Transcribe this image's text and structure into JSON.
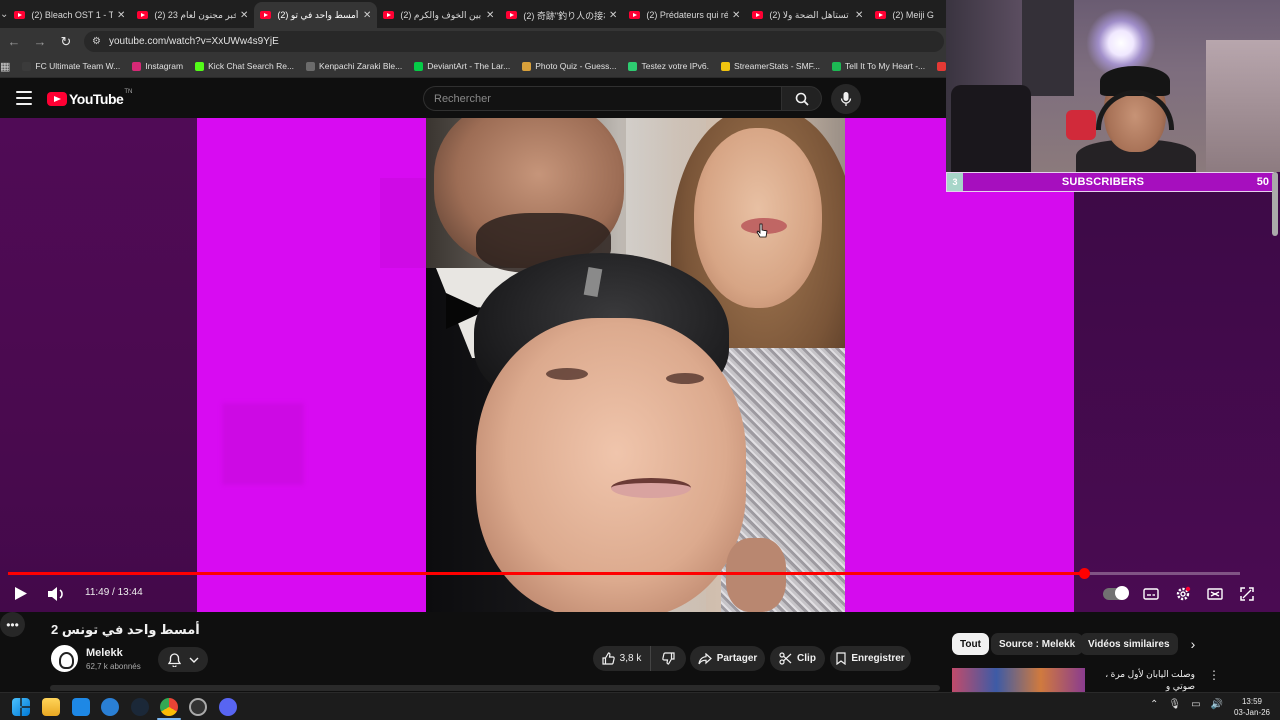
{
  "browser": {
    "tabs": [
      {
        "title": "(2) Bleach OST 1 - Tra",
        "active": false
      },
      {
        "title": "(2) 23 خبر مجنون لعام",
        "active": false
      },
      {
        "title": "(2) أمسط واحد في تو",
        "active": true
      },
      {
        "title": "(2) بين الخوف والكرم",
        "active": false
      },
      {
        "title": "(2) 奇跡\"釣り人の接れ",
        "active": false
      },
      {
        "title": "(2) Prédateurs qui ré",
        "active": false
      },
      {
        "title": "(2) تستاهل الضحة ولا",
        "active": false
      },
      {
        "title": "(2) Meiji G",
        "active": false
      }
    ],
    "url": "youtube.com/watch?v=XxUWw4s9YjE",
    "bookmarks": [
      {
        "label": "FC Ultimate Team W...",
        "color": "#3b3b3b"
      },
      {
        "label": "Instagram",
        "color": "#d62976"
      },
      {
        "label": "Kick Chat Search Re...",
        "color": "#53fc18"
      },
      {
        "label": "Kenpachi Zaraki Ble...",
        "color": "#6b6b6b"
      },
      {
        "label": "DeviantArt - The Lar...",
        "color": "#05cc47"
      },
      {
        "label": "Photo Quiz - Guess...",
        "color": "#d9a13b"
      },
      {
        "label": "Testez votre IPv6.",
        "color": "#2ecc71"
      },
      {
        "label": "StreamerStats - SMF...",
        "color": "#f1c40f"
      },
      {
        "label": "Tell It To My Heart -...",
        "color": "#1db954"
      },
      {
        "label": "GlobalN",
        "color": "#e53935"
      }
    ]
  },
  "youtube": {
    "logo_text": "YouTube",
    "logo_suffix": "TN",
    "search_placeholder": "Rechercher"
  },
  "player": {
    "time": "11:49 / 13:44",
    "progress": 0.873
  },
  "video": {
    "title": "أمسط واحد في تونس 2",
    "channel": "Melekk",
    "subscribers": "62,7 k abonnés",
    "likes": "3,8 k",
    "share_label": "Partager",
    "clip_label": "Clip",
    "save_label": "Enregistrer"
  },
  "chips": [
    "Tout",
    "Source : Melekk",
    "Vidéos similaires"
  ],
  "recommendation": {
    "title": "وصلت اليابان لأول مرة ، صوتي و"
  },
  "overlay": {
    "count": "3",
    "label": "SUBSCRIBERS",
    "goal": "50"
  },
  "taskbar": {
    "time": "13:59",
    "date": "03-Jan-26"
  },
  "colors": {
    "accent_red": "#ff0000",
    "magenta": "#d80bf2",
    "overlay_purple": "#a60fbe"
  }
}
